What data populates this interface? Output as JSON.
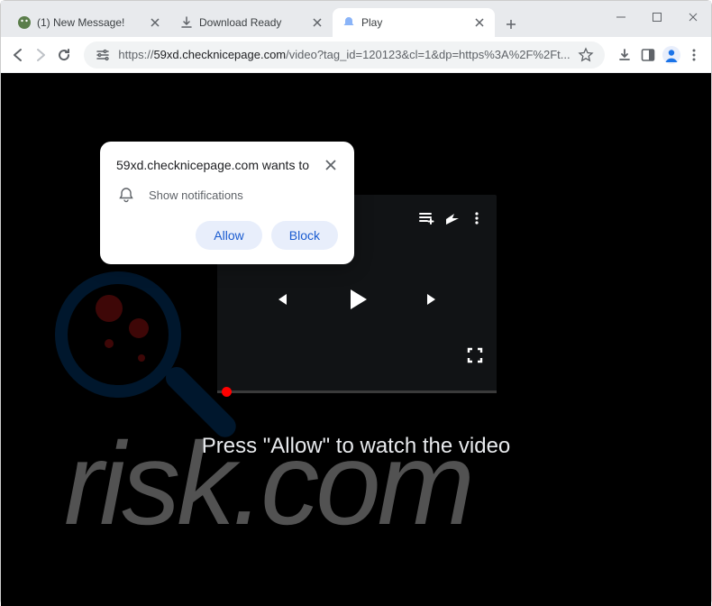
{
  "window": {
    "tabs": [
      {
        "title": "(1) New Message!",
        "active": false
      },
      {
        "title": "Download Ready",
        "active": false
      },
      {
        "title": "Play",
        "active": true
      }
    ]
  },
  "toolbar": {
    "url_prefix": "https://",
    "url_host": "59xd.checknicepage.com",
    "url_path": "/video?tag_id=120123&cl=1&dp=https%3A%2F%2Ft..."
  },
  "popup": {
    "title": "59xd.checknicepage.com wants to",
    "message": "Show notifications",
    "allow_label": "Allow",
    "block_label": "Block"
  },
  "page": {
    "caption": "Press \"Allow\" to watch the video"
  },
  "watermark": {
    "text": "risk.com"
  }
}
